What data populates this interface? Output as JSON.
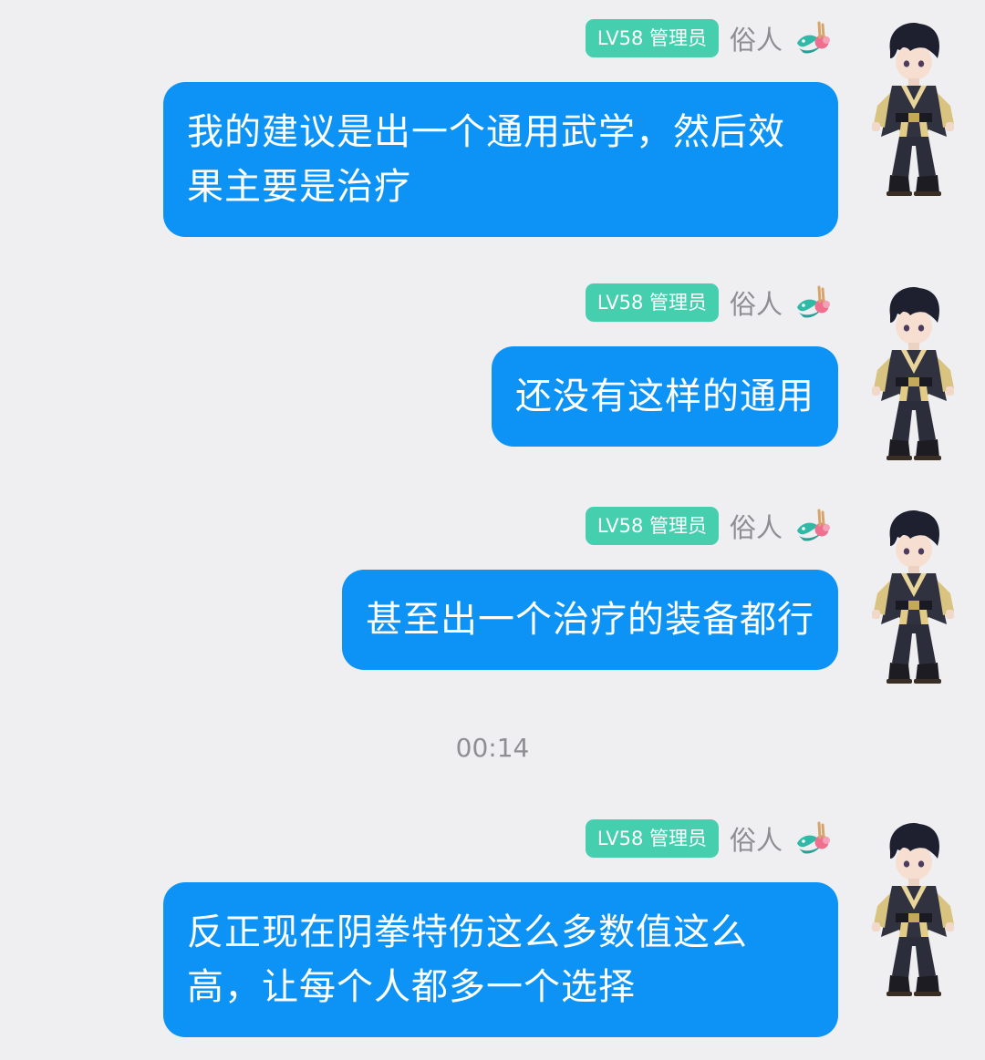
{
  "messages": [
    {
      "level_badge": "LV58 管理员",
      "sender": "俗人",
      "text": "我的建议是出一个通用武学，然后效果主要是治疗"
    },
    {
      "level_badge": "LV58 管理员",
      "sender": "俗人",
      "text": "还没有这样的通用"
    },
    {
      "level_badge": "LV58 管理员",
      "sender": "俗人",
      "text": "甚至出一个治疗的装备都行"
    },
    {
      "level_badge": "LV58 管理员",
      "sender": "俗人",
      "text": "反正现在阴拳特伤这么多数值这么高，让每个人都多一个选择"
    }
  ],
  "timestamp": "00:14",
  "colors": {
    "background": "#efeff2",
    "bubble": "#0c93f5",
    "bubble_text": "#ffffff",
    "badge": "#45cfae",
    "nickname": "#8d8d92",
    "timestamp": "#8e8e93"
  },
  "icons": [
    "dragon-title-icon",
    "avatar-character"
  ]
}
